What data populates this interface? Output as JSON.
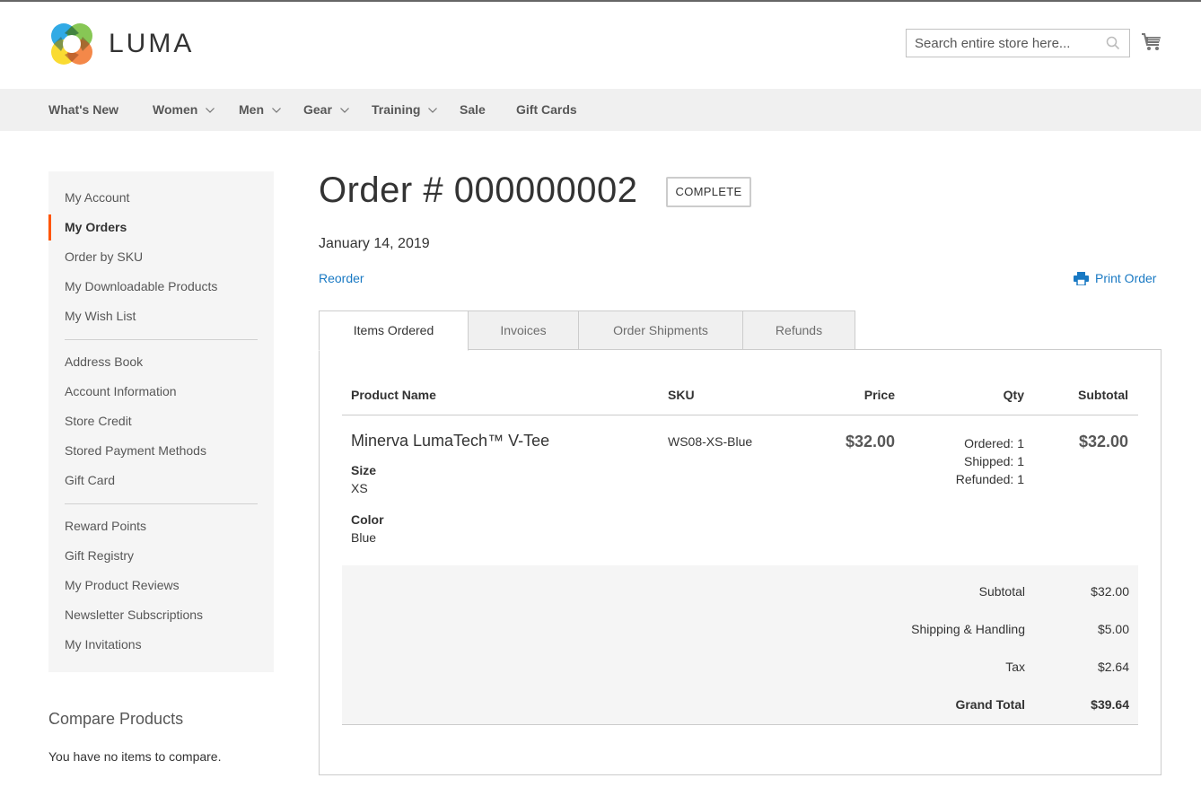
{
  "brand": {
    "name": "LUMA"
  },
  "header": {
    "search_placeholder": "Search entire store here...",
    "search_icon": "search-icon",
    "cart_icon": "cart-icon"
  },
  "nav": {
    "items": [
      {
        "label": "What's New",
        "has_dropdown": false
      },
      {
        "label": "Women",
        "has_dropdown": true
      },
      {
        "label": "Men",
        "has_dropdown": true
      },
      {
        "label": "Gear",
        "has_dropdown": true
      },
      {
        "label": "Training",
        "has_dropdown": true
      },
      {
        "label": "Sale",
        "has_dropdown": false
      },
      {
        "label": "Gift Cards",
        "has_dropdown": false
      }
    ]
  },
  "sidebar": {
    "groups": [
      [
        "My Account",
        "My Orders",
        "Order by SKU",
        "My Downloadable Products",
        "My Wish List"
      ],
      [
        "Address Book",
        "Account Information",
        "Store Credit",
        "Stored Payment Methods",
        "Gift Card"
      ],
      [
        "Reward Points",
        "Gift Registry",
        "My Product Reviews",
        "Newsletter Subscriptions",
        "My Invitations"
      ]
    ],
    "active": "My Orders",
    "active_color": "#ff5501"
  },
  "compare": {
    "title": "Compare Products",
    "empty_text": "You have no items to compare."
  },
  "order": {
    "title": "Order # 000000002",
    "status": "COMPLETE",
    "date": "January 14, 2019",
    "reorder_label": "Reorder",
    "print_label": "Print Order",
    "print_icon": "printer-icon",
    "link_color": "#1979c3"
  },
  "tabs": [
    {
      "label": "Items Ordered",
      "active": true
    },
    {
      "label": "Invoices",
      "active": false
    },
    {
      "label": "Order Shipments",
      "active": false
    },
    {
      "label": "Refunds",
      "active": false
    }
  ],
  "items_table": {
    "headers": {
      "product": "Product Name",
      "sku": "SKU",
      "price": "Price",
      "qty": "Qty",
      "subtotal": "Subtotal"
    },
    "rows": [
      {
        "name": "Minerva LumaTech™ V-Tee",
        "options": [
          {
            "label": "Size",
            "value": "XS"
          },
          {
            "label": "Color",
            "value": "Blue"
          }
        ],
        "sku": "WS08-XS-Blue",
        "price": "$32.00",
        "qty": {
          "ordered": "Ordered: 1",
          "shipped": "Shipped: 1",
          "refunded": "Refunded: 1"
        },
        "subtotal": "$32.00"
      }
    ]
  },
  "totals": [
    {
      "label": "Subtotal",
      "value": "$32.00"
    },
    {
      "label": "Shipping & Handling",
      "value": "$5.00"
    },
    {
      "label": "Tax",
      "value": "$2.64"
    },
    {
      "label": "Grand Total",
      "value": "$39.64"
    }
  ]
}
